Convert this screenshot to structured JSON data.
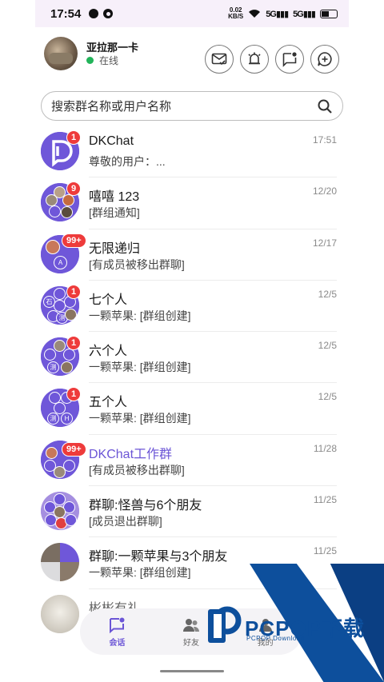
{
  "statusbar": {
    "time": "17:54",
    "net_speed_top": "0.02",
    "net_speed_bottom": "KB/S",
    "signal1": "5G",
    "signal2": "5G"
  },
  "profile": {
    "name": "亚拉那一卡",
    "status": "在线",
    "status_color": "#22b45a"
  },
  "header_actions": [
    "mail-check-icon",
    "alarm-bell-icon",
    "message-notification-icon",
    "add-chat-icon"
  ],
  "search": {
    "placeholder": "搜索群名称或用户名称"
  },
  "conversations": [
    {
      "title": "DKChat",
      "preview": "尊敬的用户：...",
      "time": "17:51",
      "badge": "1",
      "accent": false
    },
    {
      "title": "嘻嘻 123",
      "preview": "[群组通知]",
      "time": "12/20",
      "badge": "9",
      "accent": false
    },
    {
      "title": "无限递归",
      "preview": "[有成员被移出群聊]",
      "time": "12/17",
      "badge": "99+",
      "accent": false
    },
    {
      "title": "七个人",
      "preview": "一颗苹果: [群组创建]",
      "time": "12/5",
      "badge": "1",
      "accent": false
    },
    {
      "title": "六个人",
      "preview": "一颗苹果: [群组创建]",
      "time": "12/5",
      "badge": "1",
      "accent": false
    },
    {
      "title": "五个人",
      "preview": "一颗苹果: [群组创建]",
      "time": "12/5",
      "badge": "1",
      "accent": false
    },
    {
      "title": "DKChat工作群",
      "preview": "[有成员被移出群聊]",
      "time": "11/28",
      "badge": "99+",
      "accent": true
    },
    {
      "title": "群聊:怪兽与6个朋友",
      "preview": "[成员退出群聊]",
      "time": "11/25",
      "badge": "",
      "accent": false
    },
    {
      "title": "群聊:一颗苹果与3个朋友",
      "preview": "一颗苹果: [群组创建]",
      "time": "11/25",
      "badge": "",
      "accent": false
    },
    {
      "title": "彬彬有礼",
      "preview": "",
      "time": "",
      "badge": "",
      "accent": false
    }
  ],
  "mini_avatar_labels": {
    "a": "A",
    "shi": "石",
    "ce": "测",
    "h": "H"
  },
  "bottom_nav": [
    {
      "label": "会话",
      "icon": "chat-bubble-icon",
      "active": true
    },
    {
      "label": "好友",
      "icon": "friends-icon",
      "active": false
    },
    {
      "label": "我的",
      "icon": "profile-icon",
      "active": false
    }
  ],
  "watermark": {
    "brand": "PCPOP下载",
    "sub": "PCPOP Download"
  },
  "colors": {
    "accent": "#6b55d6",
    "badge": "#ee3b3b",
    "group_avatar": "#6f57d9",
    "statusbar_bg": "#f7f0fa",
    "watermark_blue": "#0d4f9c"
  }
}
